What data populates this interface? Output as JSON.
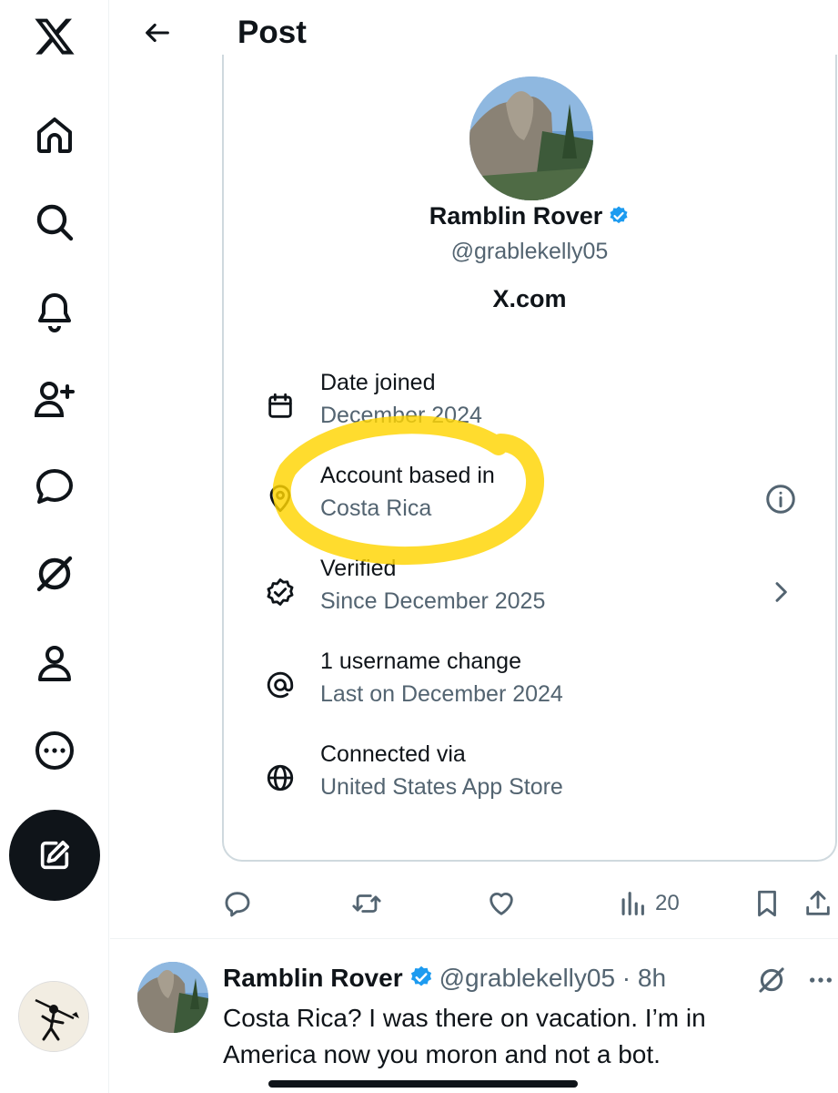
{
  "header": {
    "title": "Post"
  },
  "profile": {
    "name": "Ramblin Rover",
    "handle": "@grablekelly05",
    "site": "X.com"
  },
  "about": [
    {
      "icon": "calendar-icon",
      "title": "Date joined",
      "value": "December 2024"
    },
    {
      "icon": "location-pin-icon",
      "title": "Account based in",
      "value": "Costa Rica"
    },
    {
      "icon": "verified-badge-icon",
      "title": "Verified",
      "value": "Since December 2025"
    },
    {
      "icon": "at-sign-icon",
      "title": "1 username change",
      "value": "Last on December 2024"
    },
    {
      "icon": "globe-icon",
      "title": "Connected via",
      "value": "United States App Store"
    }
  ],
  "actions": {
    "views": "20"
  },
  "reply": {
    "name": "Ramblin Rover",
    "handle": "@grablekelly05",
    "time": " · 8h",
    "text": "Costa Rica? I was there on vacation. I’m in America now you moron and not a bot."
  },
  "colors": {
    "accent": "#1d9bf0",
    "highlight": "#ffd400",
    "muted": "#536471",
    "text": "#0f1419"
  }
}
